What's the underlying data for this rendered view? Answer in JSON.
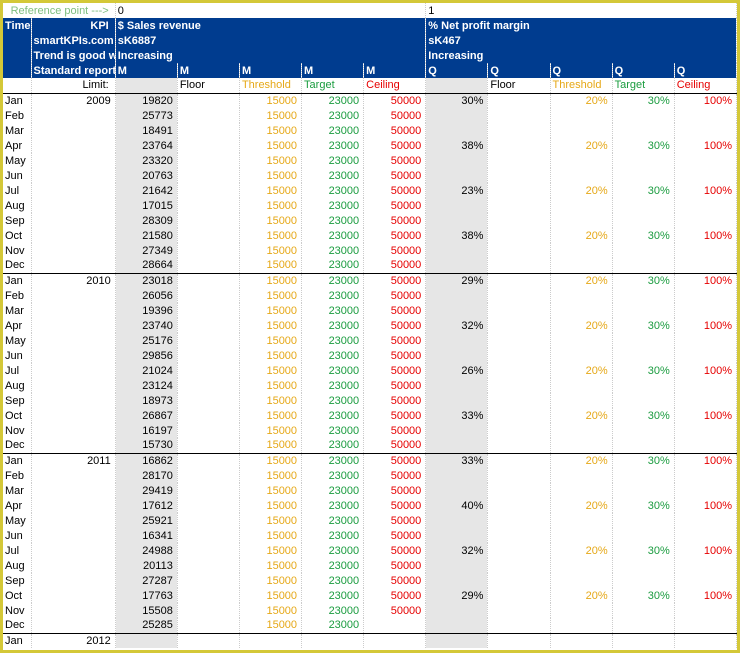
{
  "header": {
    "ref_point_label": "Reference point --->",
    "ref0": "0",
    "ref1": "1",
    "rows": {
      "time": "Time",
      "kpi": "KPI",
      "smartkpi": "smartKPIs.com #",
      "trend": "Trend is good when (figures",
      "standard": "Standard reporting"
    },
    "kpi0": {
      "name": "$ Sales revenue",
      "code": "sK6887",
      "trend": "Increasing",
      "freq": "M"
    },
    "kpi1": {
      "name": "% Net profit margin",
      "code": "sK467",
      "trend": "Increasing",
      "freq": "Q"
    },
    "freq_cols0": [
      "M",
      "M",
      "M",
      "M"
    ],
    "freq_cols1": [
      "Q",
      "Q",
      "Q",
      "Q"
    ],
    "limit_label": "Limit:",
    "limit_cols": [
      "Floor",
      "Threshold",
      "Target",
      "Ceiling"
    ]
  },
  "months": [
    "Jan",
    "Feb",
    "Mar",
    "Apr",
    "May",
    "Jun",
    "Jul",
    "Aug",
    "Sep",
    "Oct",
    "Nov",
    "Dec"
  ],
  "years": [
    {
      "year": "2009",
      "sales": [
        19820,
        25773,
        18491,
        23764,
        23320,
        20763,
        21642,
        17015,
        28309,
        21580,
        27349,
        28664
      ],
      "sales_floor": [
        "",
        "",
        "",
        "",
        "",
        "",
        "",
        "",
        "",
        "",
        "",
        ""
      ],
      "sales_thresh": [
        15000,
        15000,
        15000,
        15000,
        15000,
        15000,
        15000,
        15000,
        15000,
        15000,
        15000,
        15000
      ],
      "sales_target": [
        23000,
        23000,
        23000,
        23000,
        23000,
        23000,
        23000,
        23000,
        23000,
        23000,
        23000,
        23000
      ],
      "sales_ceil": [
        50000,
        50000,
        50000,
        50000,
        50000,
        50000,
        50000,
        50000,
        50000,
        50000,
        50000,
        50000
      ],
      "margin": [
        "30%",
        "",
        "",
        "38%",
        "",
        "",
        "23%",
        "",
        "",
        "38%",
        "",
        ""
      ],
      "m_thresh": [
        "20%",
        "",
        "",
        "20%",
        "",
        "",
        "20%",
        "",
        "",
        "20%",
        "",
        ""
      ],
      "m_target": [
        "30%",
        "",
        "",
        "30%",
        "",
        "",
        "30%",
        "",
        "",
        "30%",
        "",
        ""
      ],
      "m_ceil": [
        "100%",
        "",
        "",
        "100%",
        "",
        "",
        "100%",
        "",
        "",
        "100%",
        "",
        ""
      ]
    },
    {
      "year": "2010",
      "sales": [
        23018,
        26056,
        19396,
        23740,
        25176,
        29856,
        21024,
        23124,
        18973,
        26867,
        16197,
        15730
      ],
      "sales_floor": [
        "",
        "",
        "",
        "",
        "",
        "",
        "",
        "",
        "",
        "",
        "",
        ""
      ],
      "sales_thresh": [
        15000,
        15000,
        15000,
        15000,
        15000,
        15000,
        15000,
        15000,
        15000,
        15000,
        15000,
        15000
      ],
      "sales_target": [
        23000,
        23000,
        23000,
        23000,
        23000,
        23000,
        23000,
        23000,
        23000,
        23000,
        23000,
        23000
      ],
      "sales_ceil": [
        50000,
        50000,
        50000,
        50000,
        50000,
        50000,
        50000,
        50000,
        50000,
        50000,
        50000,
        50000
      ],
      "margin": [
        "29%",
        "",
        "",
        "32%",
        "",
        "",
        "26%",
        "",
        "",
        "33%",
        "",
        ""
      ],
      "m_thresh": [
        "20%",
        "",
        "",
        "20%",
        "",
        "",
        "20%",
        "",
        "",
        "20%",
        "",
        ""
      ],
      "m_target": [
        "30%",
        "",
        "",
        "30%",
        "",
        "",
        "30%",
        "",
        "",
        "30%",
        "",
        ""
      ],
      "m_ceil": [
        "100%",
        "",
        "",
        "100%",
        "",
        "",
        "100%",
        "",
        "",
        "100%",
        "",
        ""
      ]
    },
    {
      "year": "2011",
      "sales": [
        16862,
        28170,
        29419,
        17612,
        25921,
        16341,
        24988,
        20113,
        27287,
        17763,
        15508,
        25285
      ],
      "sales_floor": [
        "",
        "",
        "",
        "",
        "",
        "",
        "",
        "",
        "",
        "",
        "",
        ""
      ],
      "sales_thresh": [
        15000,
        15000,
        15000,
        15000,
        15000,
        15000,
        15000,
        15000,
        15000,
        15000,
        15000,
        15000
      ],
      "sales_target": [
        23000,
        23000,
        23000,
        23000,
        23000,
        23000,
        23000,
        23000,
        23000,
        23000,
        23000,
        23000
      ],
      "sales_ceil": [
        50000,
        50000,
        50000,
        50000,
        50000,
        50000,
        50000,
        50000,
        50000,
        50000,
        50000,
        ""
      ],
      "margin": [
        "33%",
        "",
        "",
        "40%",
        "",
        "",
        "32%",
        "",
        "",
        "29%",
        "",
        ""
      ],
      "m_thresh": [
        "20%",
        "",
        "",
        "20%",
        "",
        "",
        "20%",
        "",
        "",
        "20%",
        "",
        ""
      ],
      "m_target": [
        "30%",
        "",
        "",
        "30%",
        "",
        "",
        "30%",
        "",
        "",
        "30%",
        "",
        ""
      ],
      "m_ceil": [
        "100%",
        "",
        "",
        "100%",
        "",
        "",
        "100%",
        "",
        "",
        "100%",
        "",
        ""
      ]
    },
    {
      "year": "2012",
      "sales": [
        ""
      ],
      "sales_floor": [
        ""
      ],
      "sales_thresh": [
        ""
      ],
      "sales_target": [
        ""
      ],
      "sales_ceil": [
        ""
      ],
      "margin": [
        ""
      ],
      "m_thresh": [
        ""
      ],
      "m_target": [
        ""
      ],
      "m_ceil": [
        ""
      ]
    }
  ]
}
